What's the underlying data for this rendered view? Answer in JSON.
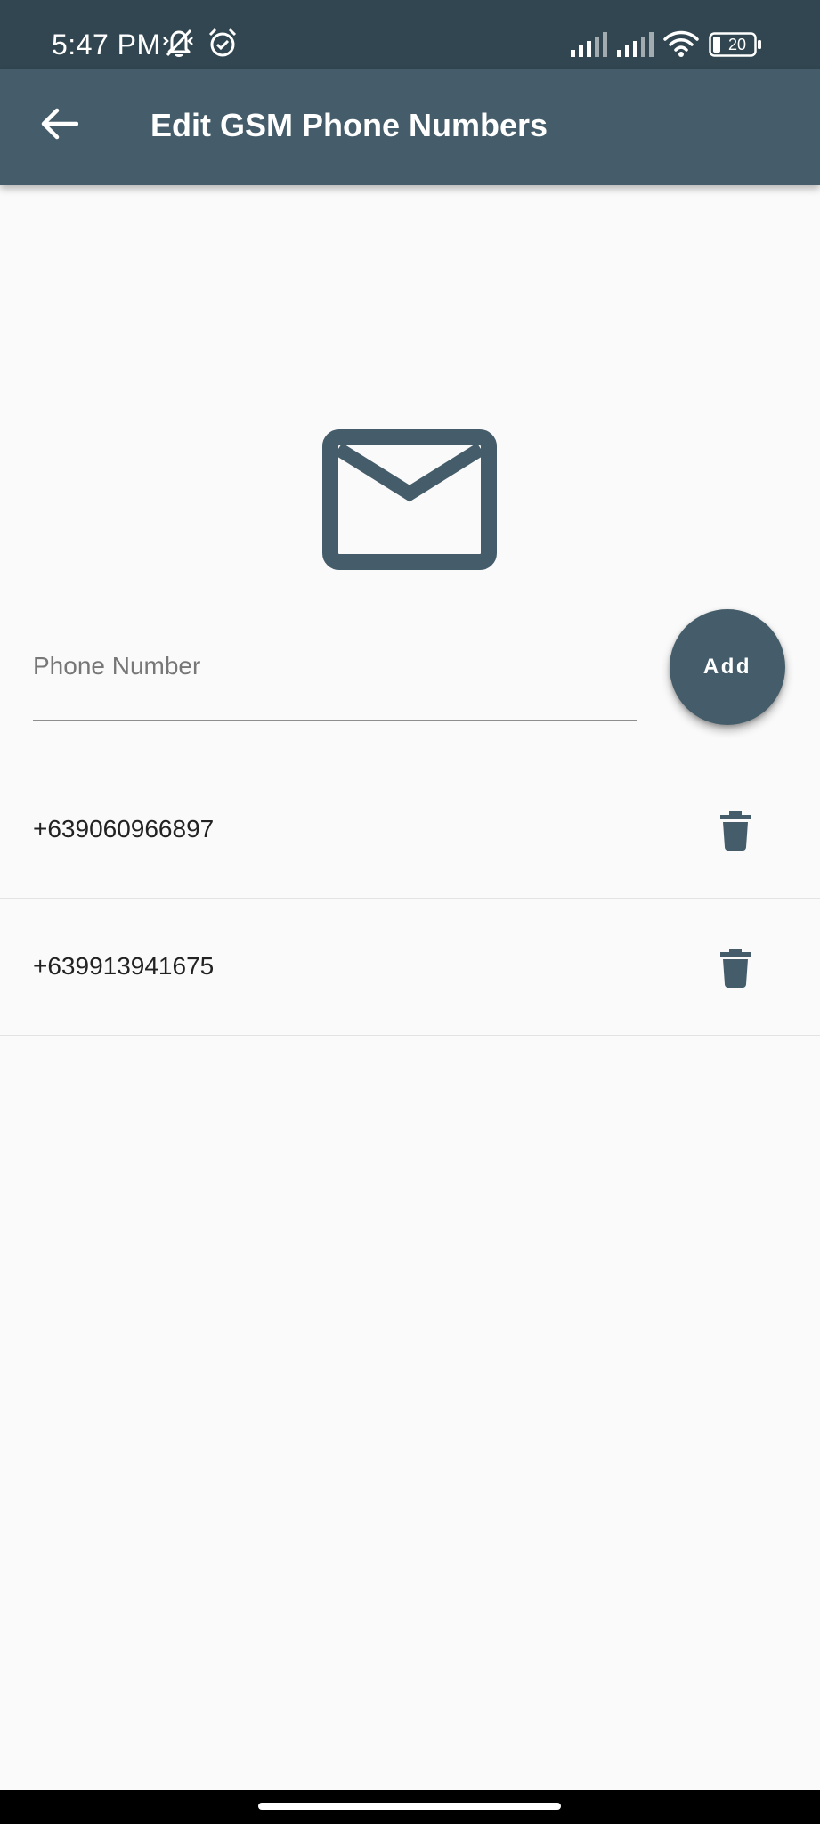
{
  "status_bar": {
    "time": "5:47 PM",
    "battery": "20",
    "icons": [
      "mute-vibrate-icon",
      "alarm-icon",
      "signal-icon",
      "signal-icon",
      "wifi-icon",
      "battery-icon"
    ]
  },
  "app_bar": {
    "back_icon": "arrow-back-icon",
    "title": "Edit GSM Phone Numbers"
  },
  "form": {
    "icon": "email-icon",
    "phone_input": {
      "placeholder": "Phone Number",
      "value": ""
    },
    "add_label": "Add"
  },
  "numbers": [
    {
      "number": "+639060966897",
      "delete_icon": "trash-icon"
    },
    {
      "number": "+639913941675",
      "delete_icon": "trash-icon"
    }
  ],
  "colors": {
    "status_bar": "#314650",
    "app_bar": "#455d6a",
    "accent": "#455d6a",
    "background": "#fafafa"
  }
}
